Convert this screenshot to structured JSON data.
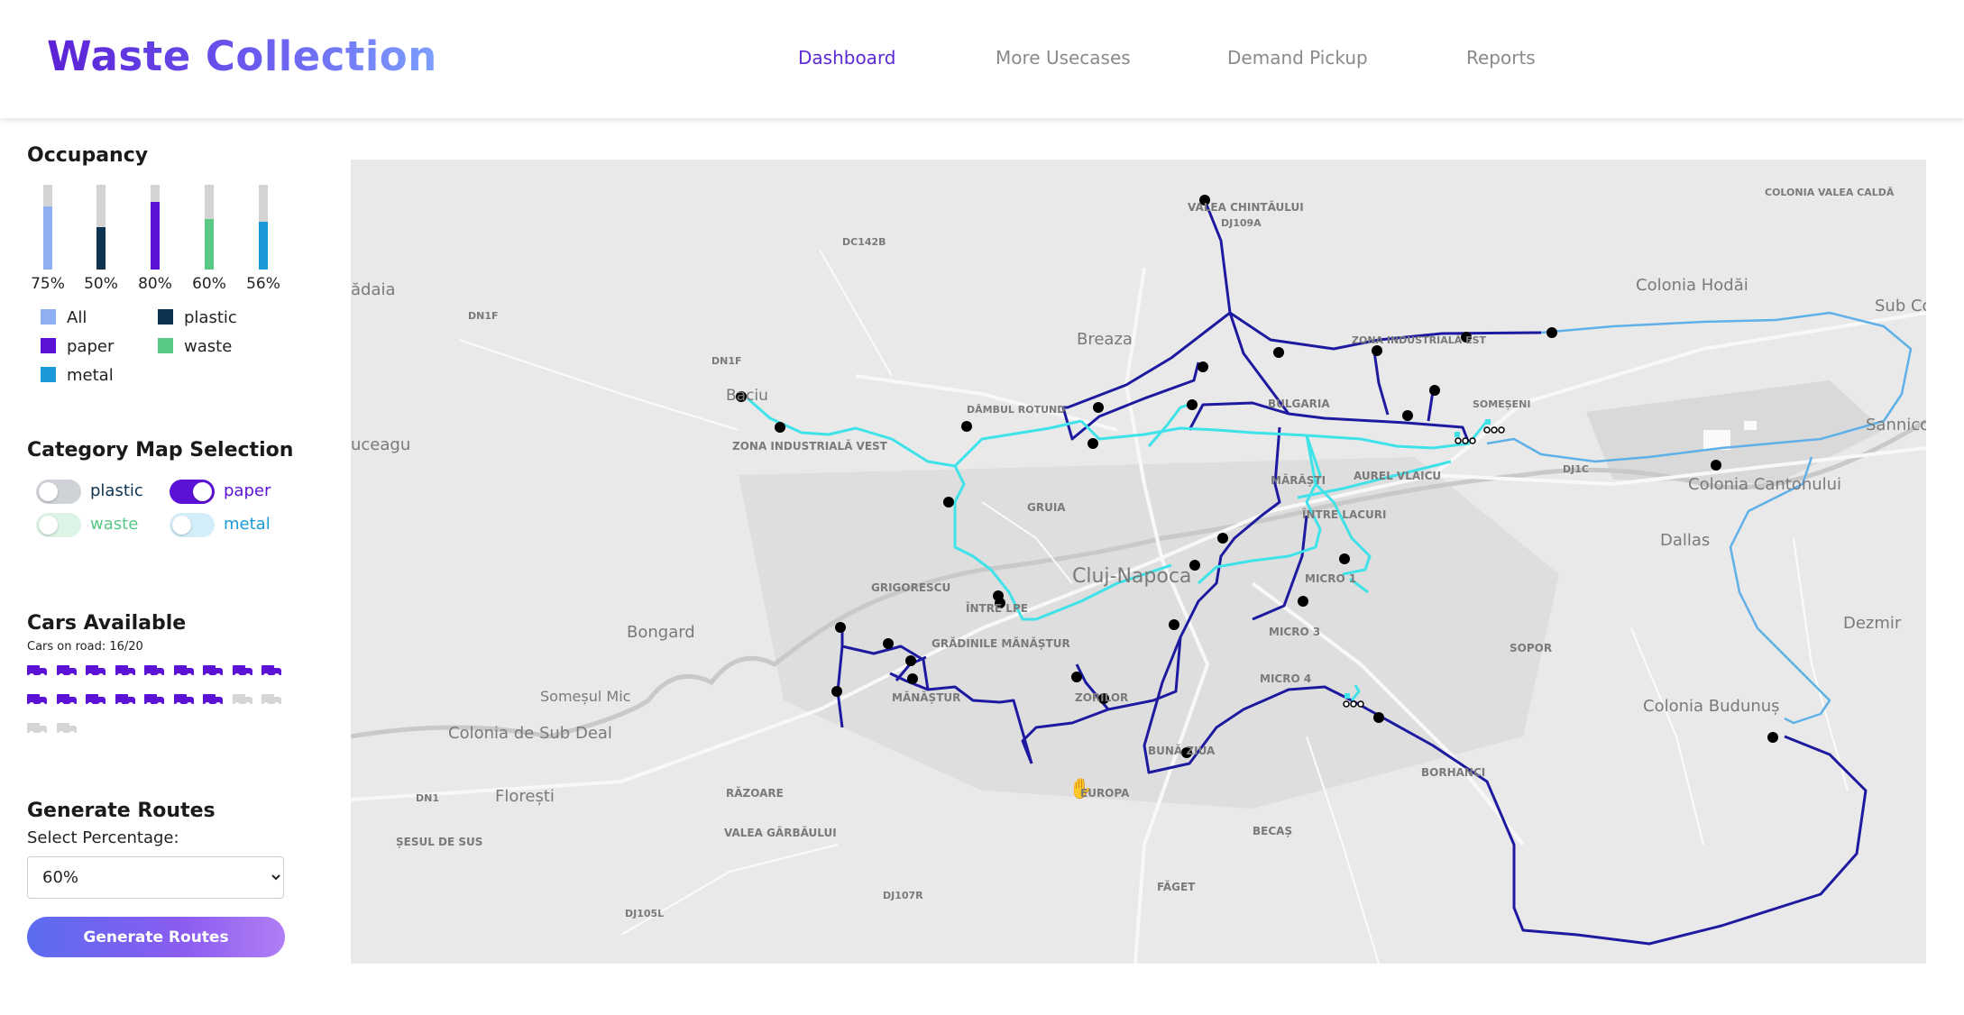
{
  "app": {
    "title": "Waste Collection"
  },
  "nav": [
    {
      "label": "Dashboard",
      "active": true
    },
    {
      "label": "More Usecases",
      "active": false
    },
    {
      "label": "Demand Pickup",
      "active": false
    },
    {
      "label": "Reports",
      "active": false
    }
  ],
  "occupancy": {
    "title": "Occupancy",
    "bars": [
      {
        "category": "All",
        "percent_label": "75%",
        "value": 0.75,
        "color": "#8fb0f2"
      },
      {
        "category": "plastic",
        "percent_label": "50%",
        "value": 0.5,
        "color": "#0d3350"
      },
      {
        "category": "paper",
        "percent_label": "80%",
        "value": 0.8,
        "color": "#5b12d6"
      },
      {
        "category": "waste",
        "percent_label": "60%",
        "value": 0.6,
        "color": "#58c884"
      },
      {
        "category": "metal",
        "percent_label": "56%",
        "value": 0.56,
        "color": "#1a9ad8"
      }
    ],
    "legend": [
      {
        "label": "All",
        "color": "#8fb0f2"
      },
      {
        "label": "plastic",
        "color": "#0d3350"
      },
      {
        "label": "paper",
        "color": "#5b12d6"
      },
      {
        "label": "waste",
        "color": "#58c884"
      },
      {
        "label": "metal",
        "color": "#1a9ad8"
      }
    ]
  },
  "category_map": {
    "title": "Category Map Selection",
    "toggles": [
      {
        "label": "plastic",
        "on": false,
        "track_color": "#cfd3d8",
        "text_color": "#0d3350"
      },
      {
        "label": "paper",
        "on": true,
        "track_color": "#5b12d6",
        "text_color": "#5b12d6"
      },
      {
        "label": "waste",
        "on": false,
        "track_color": "#ddf3e6",
        "text_color": "#58c884"
      },
      {
        "label": "metal",
        "on": false,
        "track_color": "#d3edf9",
        "text_color": "#1a9ad8"
      }
    ]
  },
  "cars": {
    "title": "Cars Available",
    "on_road_text": "Cars on road: 16/20",
    "on_road": 16,
    "total": 20,
    "active_color": "#5b12d6",
    "inactive_color": "#d5d5d5"
  },
  "generate": {
    "title": "Generate Routes",
    "select_label": "Select Percentage:",
    "selected": "60%",
    "button_label": "Generate Routes"
  },
  "map": {
    "place_labels": [
      "VALEA CHINTĂULUI",
      "DJ109A",
      "DC142B",
      "ădaia",
      "DN1F",
      "DN1F",
      "Breaza",
      "Baciu",
      "DÂMBUL ROTUND",
      "ZONA INDUSTRIALĂ VEST",
      "uceagu",
      "ZONA INDUSTRIALĂ EST",
      "BULGARIA",
      "SOMEȘENI",
      "MĂRĂȘTI",
      "AUREL VLAICU",
      "ÎNTRE LACURI",
      "GRUIA",
      "Cluj-Napoca",
      "GRIGORESCU",
      "ÎNTRE LPE",
      "GRĂDINILE MĂNĂȘTUR",
      "Bongard",
      "MICRO 1",
      "MICRO 3",
      "MICRO 4",
      "MĂNĂȘTUR",
      "ZORILOR",
      "BUNĂ ZIUA",
      "EUROPA",
      "Someșul Mic",
      "Colonia de Sub Deal",
      "DN1",
      "Florești",
      "RĂZOARE",
      "VALEA GÂRBĂULUI",
      "ȘESUL DE SUS",
      "DJ105L",
      "DJ107R",
      "FĂGET",
      "BECAȘ",
      "BORHANCI",
      "SOPOR",
      "Colonia Budunuș",
      "Dezmir",
      "Dallas",
      "Colonia Cantonului",
      "DJ1C",
      "Sannicoa",
      "Sub Coa",
      "Colonia Hodăi",
      "COLONIA VALEA CALDĂ"
    ],
    "colors": {
      "route_paper": "#1e1aa0",
      "route_waste": "#3ee2e8",
      "route_metal": "#5fb0e8",
      "bin": "#000000"
    }
  }
}
